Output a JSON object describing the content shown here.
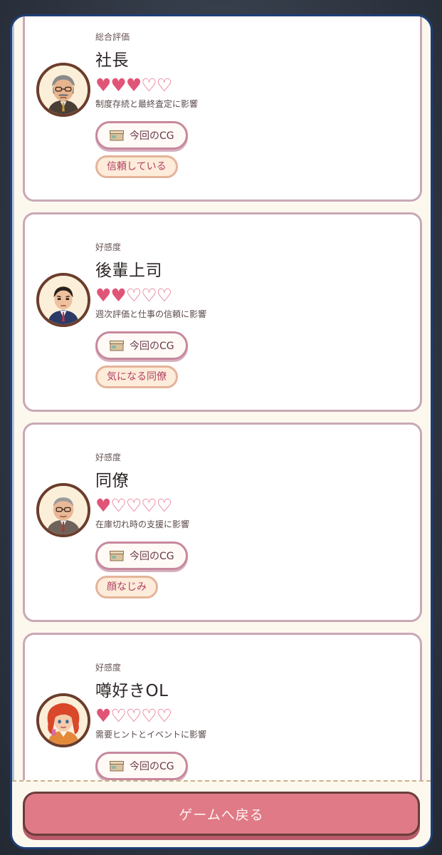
{
  "colors": {
    "accent": "#df7a86",
    "heart": "#e05577",
    "panel_border": "#1e3f78",
    "card_border": "#c9a8b6"
  },
  "characters": [
    {
      "kind_label": "総合評価",
      "name": "社長",
      "hearts_filled": "♥♥♥",
      "hearts_empty": "♡♡",
      "rating": 3,
      "rating_max": 5,
      "effect": "制度存続と最終査定に影響",
      "cg_label": "今回のCG",
      "relationship": "信頼している",
      "avatar_icon": "boss-portrait-icon"
    },
    {
      "kind_label": "好感度",
      "name": "後輩上司",
      "hearts_filled": "♥♥",
      "hearts_empty": "♡♡♡",
      "rating": 2,
      "rating_max": 5,
      "effect": "週次評価と仕事の信頼に影響",
      "cg_label": "今回のCG",
      "relationship": "気になる同僚",
      "avatar_icon": "junior-manager-portrait-icon"
    },
    {
      "kind_label": "好感度",
      "name": "同僚",
      "hearts_filled": "♥",
      "hearts_empty": "♡♡♡♡",
      "rating": 1,
      "rating_max": 5,
      "effect": "在庫切れ時の支援に影響",
      "cg_label": "今回のCG",
      "relationship": "顔なじみ",
      "avatar_icon": "coworker-portrait-icon"
    },
    {
      "kind_label": "好感度",
      "name": "噂好きOL",
      "hearts_filled": "♥",
      "hearts_empty": "♡♡♡♡",
      "rating": 1,
      "rating_max": 5,
      "effect": "需要ヒントとイベントに影響",
      "cg_label": "今回のCG",
      "relationship": "",
      "avatar_icon": "gossip-ol-portrait-icon"
    }
  ],
  "footer": {
    "back_label": "ゲームへ戻る"
  }
}
